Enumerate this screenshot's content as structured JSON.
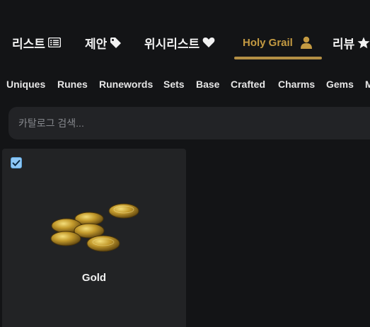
{
  "nav": {
    "items": [
      {
        "label": "리스트",
        "icon": "list-icon"
      },
      {
        "label": "제안",
        "icon": "tag-icon"
      },
      {
        "label": "위시리스트",
        "icon": "heart-icon"
      },
      {
        "label": "Holy Grail",
        "icon": "user-icon",
        "active": true
      },
      {
        "label": "리뷰",
        "icon": "star-icon"
      }
    ],
    "accent_color": "#c49a42"
  },
  "categories": [
    "Uniques",
    "Runes",
    "Runewords",
    "Sets",
    "Base",
    "Crafted",
    "Charms",
    "Gems",
    "M"
  ],
  "search": {
    "placeholder": "카탈로그 검색...",
    "value": ""
  },
  "items": [
    {
      "name": "Gold",
      "checked": true,
      "icon": "gold-coins-image"
    }
  ]
}
